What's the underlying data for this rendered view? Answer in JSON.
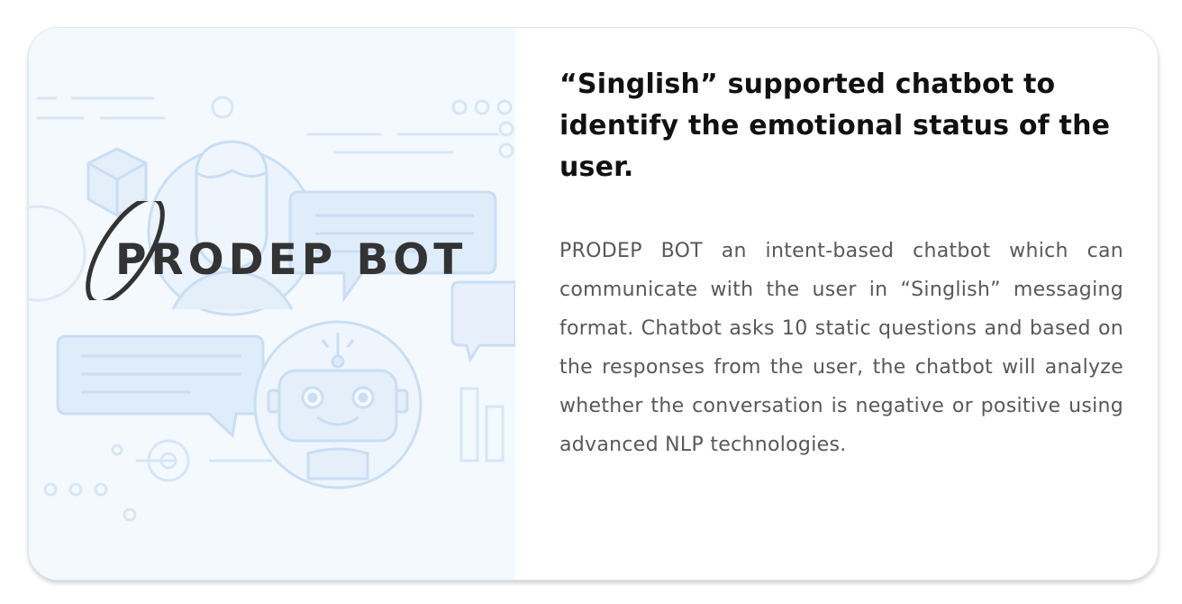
{
  "card": {
    "title": "“Singlish” supported chatbot to identify the emotional status of the user.",
    "description": "PRODEP BOT an intent-based chatbot which can communicate with the user in “Singlish” messaging format. Chatbot asks 10 static questions and based on the responses from the user, the chatbot will analyze whether the conversation is negative or positive using advanced NLP technologies.",
    "image": {
      "logo_text": "PRODEP BOT",
      "icons": [
        "person-avatar-icon",
        "robot-avatar-icon",
        "chat-bubble-icon",
        "cube-icon"
      ]
    }
  },
  "colors": {
    "title": "#111111",
    "body_text": "#585858",
    "image_background": "#f4f9fe",
    "illustration_line": "#c9def4",
    "illustration_fill": "#deebf9",
    "logo": "#333333"
  }
}
